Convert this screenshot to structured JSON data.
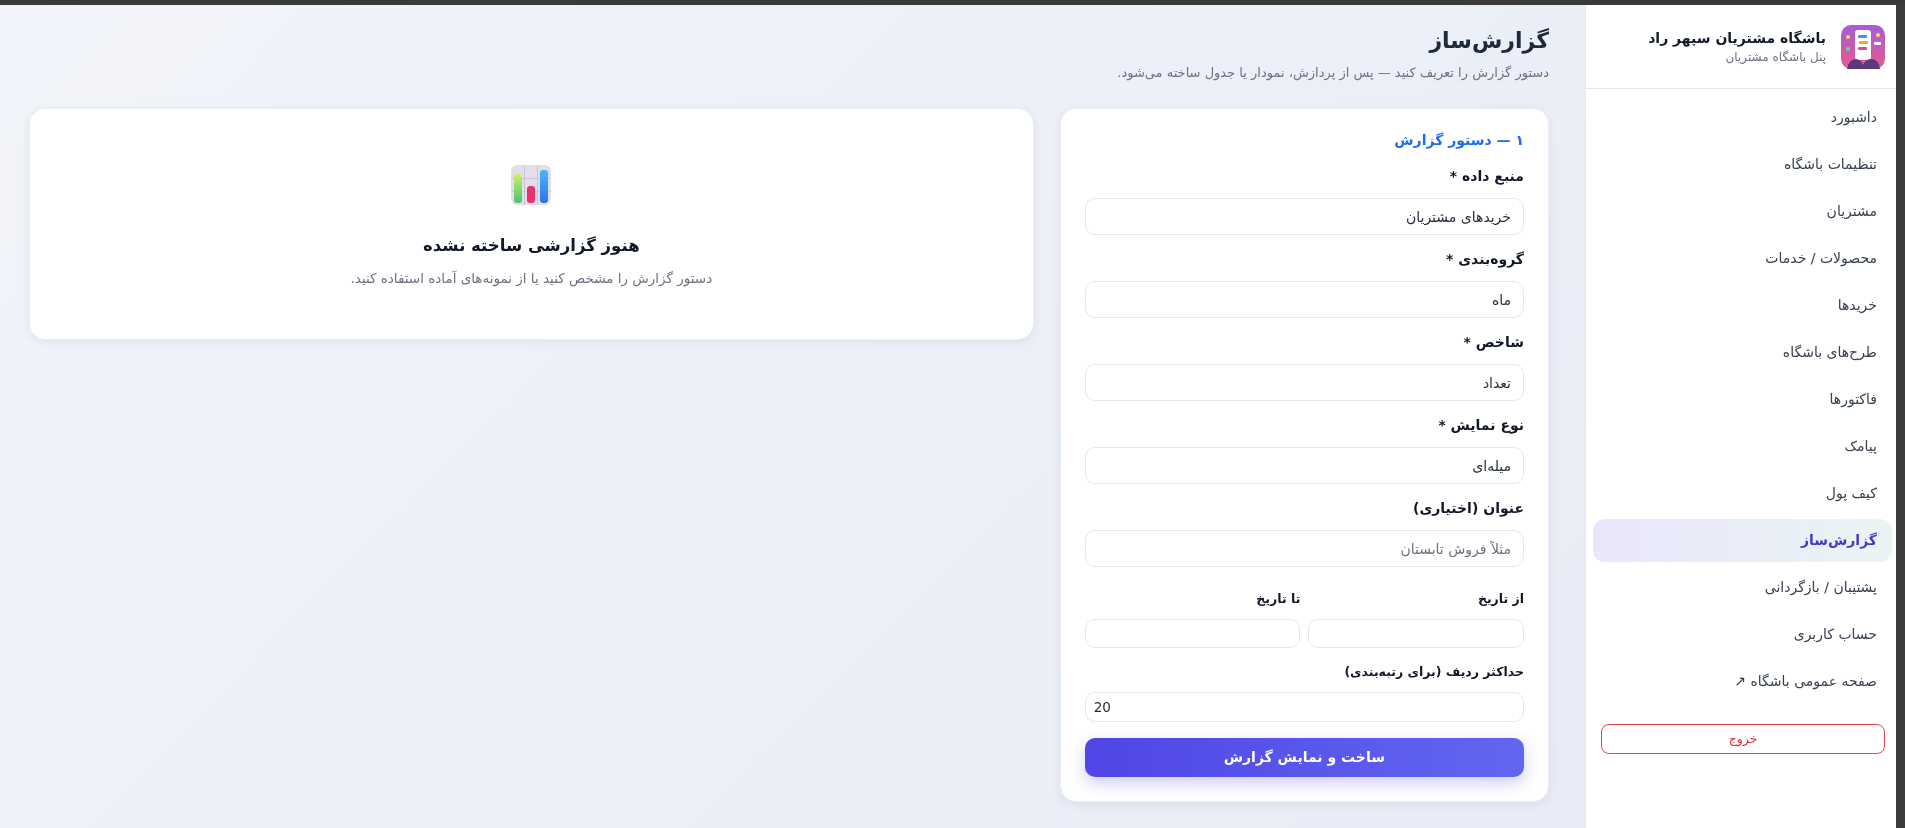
{
  "sidebar": {
    "brand": {
      "title": "باشگاه مشتریان سپهر راد",
      "subtitle": "پنل باشگاه مشتریان"
    },
    "items": [
      {
        "label": "داشبورد",
        "selected": false
      },
      {
        "label": "تنظیمات باشگاه",
        "selected": false
      },
      {
        "label": "مشتریان",
        "selected": false
      },
      {
        "label": "محصولات / خدمات",
        "selected": false
      },
      {
        "label": "خریدها",
        "selected": false
      },
      {
        "label": "طرح‌های باشگاه",
        "selected": false
      },
      {
        "label": "فاکتورها",
        "selected": false
      },
      {
        "label": "پیامک",
        "selected": false
      },
      {
        "label": "کیف پول",
        "selected": false
      },
      {
        "label": "گزارش‌ساز",
        "selected": true
      },
      {
        "label": "پشتیبان / بازگردانی",
        "selected": false
      },
      {
        "label": "حساب کاربری",
        "selected": false
      },
      {
        "label": "صفحه عمومی باشگاه ↗",
        "selected": false
      }
    ],
    "logout": "خروج"
  },
  "header": {
    "title": "گزارش‌ساز",
    "subtitle": "دستور گزارش را تعریف کنید — پس از پردازش، نمودار یا جدول ساخته می‌شود."
  },
  "form": {
    "section_title": "۱ — دستور گزارش",
    "fields": [
      {
        "kind": "text",
        "label": "منبع داده *",
        "value": "خریدهای مشتریان"
      },
      {
        "kind": "text",
        "label": "گروه‌بندی *",
        "value": "ماه"
      },
      {
        "kind": "text",
        "label": "شاخص *",
        "value": "تعداد"
      },
      {
        "kind": "text",
        "label": "نوع نمایش *",
        "value": "میله‌ای"
      },
      {
        "kind": "text",
        "label": "عنوان (اختیاری)",
        "placeholder": "مثلاً فروش تابستان"
      },
      {
        "kind": "date_range",
        "parts": [
          {
            "label": "از تاریخ"
          },
          {
            "label": "تا تاریخ"
          }
        ]
      },
      {
        "kind": "number",
        "label": "حداکثر ردیف (برای رتبه‌بندی)",
        "value": "20"
      }
    ],
    "submit": "ساخت و نمایش گزارش"
  },
  "empty_state": {
    "title": "هنوز گزارشی ساخته نشده",
    "text": "دستور گزارش را مشخص کنید یا از نمونه‌های آماده استفاده کنید."
  }
}
